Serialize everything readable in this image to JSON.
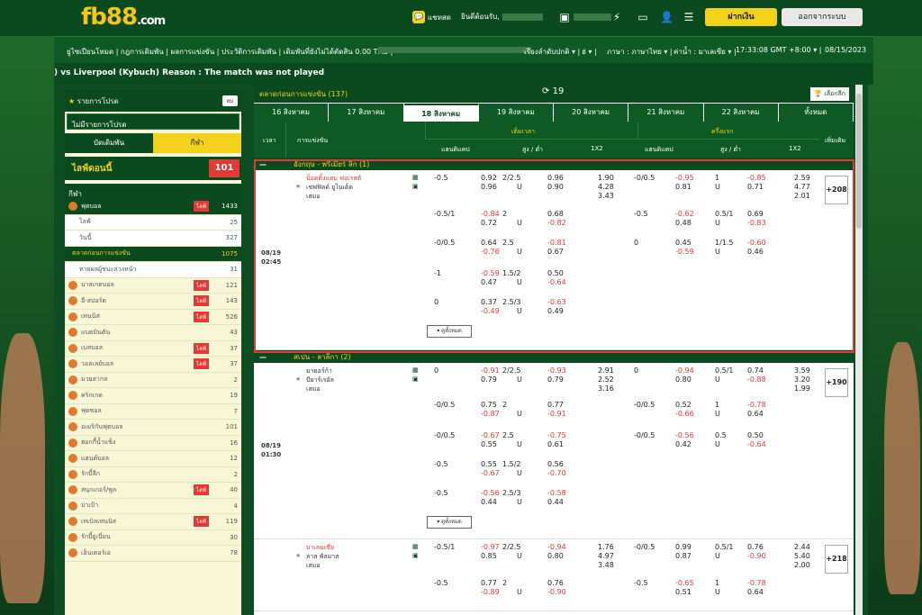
{
  "header": {
    "logo_main": "fb88",
    "logo_suffix": ".com",
    "chat": "แชทสด",
    "welcome": "ยินดีต้อนรับ,",
    "deposit": "ฝากเงิน",
    "logout": "ออกจากระบบ"
  },
  "nav": {
    "left": "ยูไซเปียนโหมด | กฎการเดิมพัน | ผลการแข่งขัน | ประวัติการเดิมพัน | เดิมพันที่ยังไม่ได้ตัดสิน 0.00 THB |",
    "sort": "เรียงลำดับปกติ",
    "odds": "ฮ่",
    "lang": "ภาษา : ภาษาไทย",
    "oddstype": "ค่าน้ำ : มาเลเซีย",
    "time": "17:33:08 GMT +8:00",
    "date": "08/15/2023"
  },
  "ticker": ") vs Liverpool (Kybuch) Reason : The match was not played",
  "sidebar": {
    "title": "รายการโปรด",
    "btn": "ลบ",
    "empty": "ไม่มีรายการโปรด",
    "tab1": "บัดเดิมพัน",
    "tab2": "กีฬา",
    "live": "ไลฟ์ดอนนี้",
    "live_count": "101",
    "sports": "กีฬา",
    "items": [
      {
        "label": "ฟุตบอล",
        "live": "ไลฟ์",
        "count": "1433",
        "cls": "sel"
      },
      {
        "label": "ไลฟ์",
        "live": "",
        "count": "25",
        "cls": "sub"
      },
      {
        "label": "วันนี้",
        "live": "",
        "count": "327",
        "cls": "sub"
      },
      {
        "label": "ตลาดก่อนการแข่งขัน",
        "live": "",
        "count": "1075",
        "cls": "sub2"
      },
      {
        "label": "ทายผลผู้ชนะล่วงหน้า",
        "live": "",
        "count": "31",
        "cls": "sub"
      },
      {
        "label": "บาสเกตบอล",
        "live": "ไลฟ์",
        "count": "121",
        "cls": ""
      },
      {
        "label": "อี-สปอร์ต",
        "live": "ไลฟ์",
        "count": "143",
        "cls": ""
      },
      {
        "label": "เทนนิส",
        "live": "ไลฟ์",
        "count": "526",
        "cls": ""
      },
      {
        "label": "แบดมินตัน",
        "live": "",
        "count": "43",
        "cls": ""
      },
      {
        "label": "เบสบอล",
        "live": "ไลฟ์",
        "count": "37",
        "cls": ""
      },
      {
        "label": "วอลเลย์บอล",
        "live": "ไลฟ์",
        "count": "37",
        "cls": ""
      },
      {
        "label": "มวยสากล",
        "live": "",
        "count": "2",
        "cls": ""
      },
      {
        "label": "คริกเกต",
        "live": "",
        "count": "19",
        "cls": ""
      },
      {
        "label": "ฟุตซอล",
        "live": "",
        "count": "7",
        "cls": ""
      },
      {
        "label": "อเมริกันฟุตบอล",
        "live": "",
        "count": "101",
        "cls": ""
      },
      {
        "label": "ฮอกกี้น้ำแข็ง",
        "live": "",
        "count": "16",
        "cls": ""
      },
      {
        "label": "แฮนด์บอล",
        "live": "",
        "count": "12",
        "cls": ""
      },
      {
        "label": "รักบี้ลีก",
        "live": "",
        "count": "2",
        "cls": ""
      },
      {
        "label": "สนุกเกอร์/พูล",
        "live": "ไลฟ์",
        "count": "40",
        "cls": ""
      },
      {
        "label": "ปาเป้า",
        "live": "",
        "count": "4",
        "cls": ""
      },
      {
        "label": "เทเบิลเทนนิส",
        "live": "ไลฟ์",
        "count": "119",
        "cls": ""
      },
      {
        "label": "รักบี้ยูเนี่ยน",
        "live": "",
        "count": "30",
        "cls": ""
      },
      {
        "label": "เอ็นเตอร์เอ",
        "live": "",
        "count": "78",
        "cls": ""
      }
    ]
  },
  "main": {
    "market": "ตลาดก่อนการแข่งขัน (137)",
    "refresh": "19",
    "calendar": "เลือกลีก",
    "days": [
      "16 สิงหาคม",
      "17 สิงหาคม",
      "18 สิงหาคม",
      "19 สิงหาคม",
      "20 สิงหาคม",
      "21 สิงหาคม",
      "22 สิงหาคม",
      "ทั้งหมด"
    ],
    "cols": {
      "time": "เวลา",
      "match": "การแข่งขัน",
      "full": "เต็มเวลา",
      "half": "ครึ่งแรก",
      "hdp": "แฮนดิแคป",
      "ou": "สูง / ต่ำ",
      "x12": "1X2",
      "more": "เพิ่มเติม"
    },
    "leagues": [
      {
        "name": "อังกฤษ - พรีเมียร์ ลีก (1)"
      },
      {
        "name": "สเปน - ลาลีกา (2)"
      }
    ],
    "m1": {
      "date": "08/19",
      "time": "02:45",
      "home": "น็อตติ้งแฮม ฟอเรสต์",
      "away": "เชฟฟิลด์ ยูไนเต็ด",
      "draw": "เสมอ",
      "more": "ดูทั้งหมด",
      "plus": "+208"
    },
    "m2": {
      "date": "08/19",
      "time": "01:30",
      "home": "มายอร์ก้า",
      "away": "บียาร์เรอัล",
      "draw": "เสมอ",
      "more": "ดูทั้งหมด",
      "plus": "+190"
    },
    "m3": {
      "home": "บาเลนเซีย",
      "away": "ลาส พัลมาส",
      "draw": "เสมอ",
      "plus": "+218"
    }
  }
}
